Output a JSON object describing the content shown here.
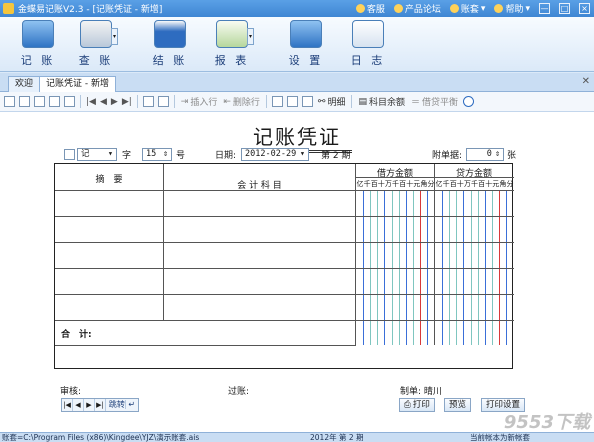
{
  "window": {
    "title": "金蝶易记账V2.3 - [记账凭证 - 新增]",
    "links": {
      "service": "客服",
      "forum": "产品论坛",
      "account": "账套",
      "help": "帮助"
    },
    "controls": {
      "minimize": "—",
      "maximize": "□",
      "close": "×"
    }
  },
  "main_toolbar": [
    {
      "label": "记 账",
      "icon": "ledger-book-icon"
    },
    {
      "label": "查 账",
      "icon": "magnify-search-icon"
    },
    {
      "label": "结 账",
      "icon": "calendar-icon"
    },
    {
      "label": "报 表",
      "icon": "chart-report-icon"
    },
    {
      "label": "设 置",
      "icon": "gear-icon"
    },
    {
      "label": "日 志",
      "icon": "log-notes-icon"
    }
  ],
  "tabs": [
    {
      "label": "欢迎"
    },
    {
      "label": "记账凭证 - 新增"
    }
  ],
  "sub_toolbar": {
    "insert_row": "插入行",
    "delete_row": "删除行",
    "detail": "明细",
    "subject_balance": "科目余额",
    "debit_credit_balance": "借贷平衡"
  },
  "voucher": {
    "title": "记账凭证",
    "type_value": "记",
    "type_suffix": "字",
    "number_value": "15",
    "number_suffix": "号",
    "date_label": "日期:",
    "date_value": "2012-02-29",
    "period_text": "第 2 期",
    "attach_label": "附单据:",
    "attach_value": "0",
    "attach_suffix": "张",
    "col_summary": "摘　要",
    "col_account": "会 计 科 目",
    "col_debit": "借方金额",
    "col_credit": "贷方金额",
    "digits": [
      "亿",
      "千",
      "百",
      "十",
      "万",
      "千",
      "百",
      "十",
      "元",
      "角",
      "分"
    ],
    "total_label": "合　计:"
  },
  "footer": {
    "audit_label": "审核:",
    "post_label": "过账:",
    "maker_label": "制单:",
    "maker_value": "晴川",
    "turn_label": "跳转",
    "print": "打印",
    "preview": "预览",
    "print_settings": "打印设置"
  },
  "status_bar": {
    "path": "账套=C:\\Program Files (x86)\\Kingdee\\YJZ\\演示账套.ais",
    "period": "2012年 第 2 期",
    "status": "当前帐本为新帐套"
  },
  "watermark": "9553下载",
  "colors": {
    "accent": "#3f86d3",
    "toolbar_bg": "#dbe9f8",
    "red_line": "#d83a3a",
    "blue_line": "#3a6fd8"
  }
}
